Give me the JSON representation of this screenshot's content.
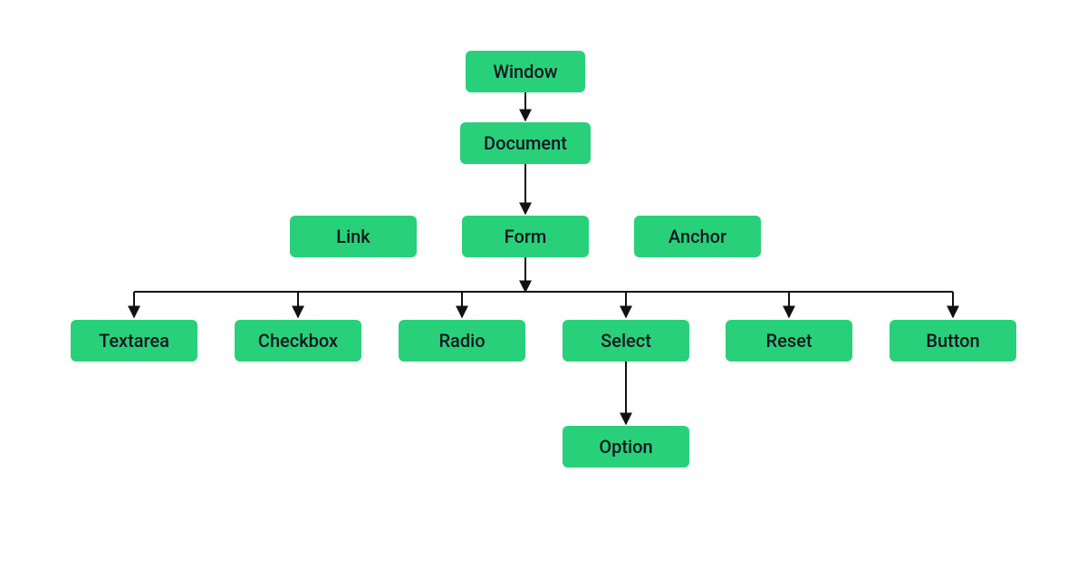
{
  "diagram": {
    "nodes": {
      "window": "Window",
      "document": "Document",
      "link": "Link",
      "form": "Form",
      "anchor": "Anchor",
      "textarea": "Textarea",
      "checkbox": "Checkbox",
      "radio": "Radio",
      "select": "Select",
      "reset": "Reset",
      "button": "Button",
      "option": "Option"
    },
    "edges": [
      [
        "window",
        "document"
      ],
      [
        "document",
        "form"
      ],
      [
        "form",
        "textarea"
      ],
      [
        "form",
        "checkbox"
      ],
      [
        "form",
        "radio"
      ],
      [
        "form",
        "select"
      ],
      [
        "form",
        "reset"
      ],
      [
        "form",
        "button"
      ],
      [
        "select",
        "option"
      ]
    ],
    "siblings_of_form_row": [
      "link",
      "form",
      "anchor"
    ],
    "colors": {
      "node_bg": "#29d07a",
      "node_text": "#0f1720",
      "edge": "#111111"
    }
  }
}
